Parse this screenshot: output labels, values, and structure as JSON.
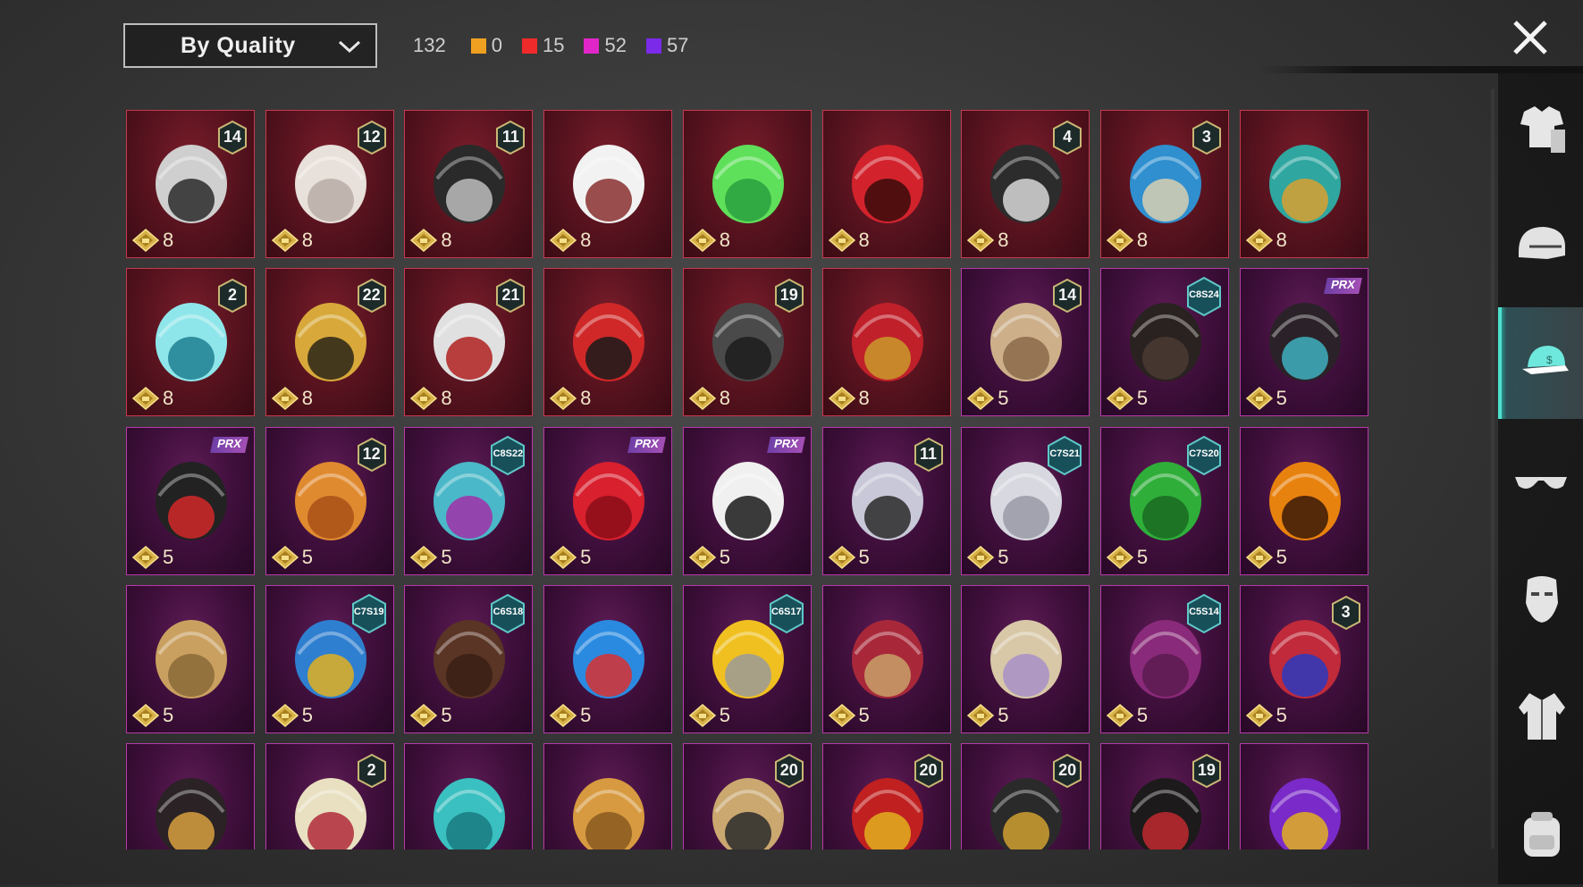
{
  "sort": {
    "label": "By Quality"
  },
  "counts": {
    "total": "132",
    "legendary": {
      "value": "0",
      "color": "#f0a020"
    },
    "mythic": {
      "value": "15",
      "color": "#ee2a2a"
    },
    "epic": {
      "value": "52",
      "color": "#e026c8"
    },
    "rare": {
      "value": "57",
      "color": "#7a2ae8"
    }
  },
  "items": [
    {
      "rarity": "mythic",
      "price": "8",
      "badge": "14",
      "icon": "cat-ear-mask-icon",
      "c1": "#cfcfcf",
      "c2": "#2a2a2a"
    },
    {
      "rarity": "mythic",
      "price": "8",
      "badge": "12",
      "icon": "white-fluffy-hair-icon",
      "c1": "#e8e0da",
      "c2": "#b8aca6"
    },
    {
      "rarity": "mythic",
      "price": "8",
      "badge": "11",
      "icon": "dark-helmet-icon",
      "c1": "#2a2a2a",
      "c2": "#bdbdbd"
    },
    {
      "rarity": "mythic",
      "price": "8",
      "badge": "",
      "icon": "white-cowboy-hat-icon",
      "c1": "#f2f2f2",
      "c2": "#8a3030"
    },
    {
      "rarity": "mythic",
      "price": "8",
      "badge": "",
      "icon": "green-hair-icon",
      "c1": "#5fe05a",
      "c2": "#2aa040"
    },
    {
      "rarity": "mythic",
      "price": "8",
      "badge": "",
      "icon": "red-helmet-icon",
      "c1": "#d2232d",
      "c2": "#3a0a0a"
    },
    {
      "rarity": "mythic",
      "price": "8",
      "badge": "4",
      "icon": "top-hat-mask-icon",
      "c1": "#2c2c2c",
      "c2": "#d8d8d8"
    },
    {
      "rarity": "mythic",
      "price": "8",
      "badge": "3",
      "icon": "joker-mask-icon",
      "c1": "#2f8fcf",
      "c2": "#d8d0b0"
    },
    {
      "rarity": "mythic",
      "price": "8",
      "badge": "",
      "icon": "dragon-helmet-icon",
      "c1": "#2fa6a0",
      "c2": "#d8a030"
    },
    {
      "rarity": "mythic",
      "price": "8",
      "badge": "2",
      "icon": "bucket-hat-goggles-icon",
      "c1": "#8fe6ea",
      "c2": "#1f7f92"
    },
    {
      "rarity": "mythic",
      "price": "8",
      "badge": "22",
      "icon": "golden-helmet-icon",
      "c1": "#d8a93a",
      "c2": "#2a2418"
    },
    {
      "rarity": "mythic",
      "price": "8",
      "badge": "21",
      "icon": "demon-mask-icon",
      "c1": "#e0e0e0",
      "c2": "#b02020"
    },
    {
      "rarity": "mythic",
      "price": "8",
      "badge": "",
      "icon": "oni-mask-icon",
      "c1": "#d02828",
      "c2": "#1a1a1a"
    },
    {
      "rarity": "mythic",
      "price": "8",
      "badge": "19",
      "icon": "knight-helmet-icon",
      "c1": "#4a4a4a",
      "c2": "#1c1c1c"
    },
    {
      "rarity": "mythic",
      "price": "8",
      "badge": "",
      "icon": "red-gold-helmet-icon",
      "c1": "#c0202a",
      "c2": "#c99a2a"
    },
    {
      "rarity": "epic",
      "price": "5",
      "badge": "14",
      "icon": "blonde-hair-flower-icon",
      "c1": "#cdb08a",
      "c2": "#8a6a48"
    },
    {
      "rarity": "epic",
      "price": "5",
      "sbadge": "C8S24",
      "icon": "black-short-hair-icon",
      "c1": "#2a2220",
      "c2": "#4a3a34"
    },
    {
      "rarity": "epic",
      "price": "5",
      "pbadge": "PRX",
      "icon": "black-hair-ribbon-icon",
      "c1": "#2a2228",
      "c2": "#3fb0c0"
    },
    {
      "rarity": "epic",
      "price": "5",
      "pbadge": "PRX",
      "icon": "cap-sunglasses-icon",
      "c1": "#222",
      "c2": "#d22828"
    },
    {
      "rarity": "epic",
      "price": "5",
      "badge": "12",
      "icon": "orange-pigtails-icon",
      "c1": "#e08a30",
      "c2": "#a85018"
    },
    {
      "rarity": "epic",
      "price": "5",
      "sbadge": "C8S22",
      "icon": "teal-purple-hair-icon",
      "c1": "#4ab8c8",
      "c2": "#a030a8"
    },
    {
      "rarity": "epic",
      "price": "5",
      "pbadge": "PRX",
      "icon": "red-hair-icon",
      "c1": "#d8202e",
      "c2": "#8a0e18"
    },
    {
      "rarity": "epic",
      "price": "5",
      "pbadge": "PRX",
      "icon": "panda-mask-icon",
      "c1": "#f0f0f0",
      "c2": "#1a1a1a"
    },
    {
      "rarity": "epic",
      "price": "5",
      "badge": "11",
      "icon": "flower-veil-hair-icon",
      "c1": "#c8c8d8",
      "c2": "#2a2a2a"
    },
    {
      "rarity": "epic",
      "price": "5",
      "sbadge": "C7S21",
      "icon": "silver-hair-icon",
      "c1": "#d8d8e0",
      "c2": "#9a9aa6"
    },
    {
      "rarity": "epic",
      "price": "5",
      "sbadge": "C7S20",
      "icon": "green-pigtails-icon",
      "c1": "#2fae3a",
      "c2": "#1a6a22"
    },
    {
      "rarity": "epic",
      "price": "5",
      "badge": "",
      "icon": "pumpkin-head-icon",
      "c1": "#e8820e",
      "c2": "#3a1a08"
    },
    {
      "rarity": "epic",
      "price": "5",
      "badge": "",
      "icon": "blonde-long-hair-icon",
      "c1": "#caa060",
      "c2": "#8a6a38"
    },
    {
      "rarity": "epic",
      "price": "5",
      "sbadge": "C7S19",
      "icon": "feather-headdress-icon",
      "c1": "#2f7fd0",
      "c2": "#e0b020"
    },
    {
      "rarity": "epic",
      "price": "5",
      "sbadge": "C6S18",
      "icon": "brown-hair-icon",
      "c1": "#5a3424",
      "c2": "#3a2016"
    },
    {
      "rarity": "epic",
      "price": "5",
      "badge": "",
      "icon": "blue-cat-cap-icon",
      "c1": "#2a8ae0",
      "c2": "#d83030"
    },
    {
      "rarity": "epic",
      "price": "5",
      "sbadge": "C6S17",
      "icon": "visor-grey-hair-icon",
      "c1": "#f0c020",
      "c2": "#9a9a9a"
    },
    {
      "rarity": "epic",
      "price": "5",
      "badge": "",
      "icon": "witch-hat-mask-icon",
      "c1": "#a8283a",
      "c2": "#c8a068"
    },
    {
      "rarity": "epic",
      "price": "5",
      "badge": "",
      "icon": "curly-blonde-hair-icon",
      "c1": "#d8c8a8",
      "c2": "#a890c8"
    },
    {
      "rarity": "epic",
      "price": "5",
      "sbadge": "C5S14",
      "icon": "magenta-hair-icon",
      "c1": "#8a2a7a",
      "c2": "#5a1a50"
    },
    {
      "rarity": "epic",
      "price": "5",
      "badge": "3",
      "icon": "jester-hat-icon",
      "c1": "#c02a3a",
      "c2": "#2a3ac0"
    },
    {
      "rarity": "epic",
      "price": "5",
      "badge": "",
      "icon": "black-hair-bow-icon",
      "c1": "#2a2224",
      "c2": "#d8a040"
    },
    {
      "rarity": "epic",
      "price": "5",
      "badge": "2",
      "icon": "blonde-bandana-icon",
      "c1": "#e8e0c0",
      "c2": "#b02a3a"
    },
    {
      "rarity": "epic",
      "price": "5",
      "badge": "",
      "icon": "teal-spiky-hair-icon",
      "c1": "#3ac0c0",
      "c2": "#1a7a80"
    },
    {
      "rarity": "epic",
      "price": "5",
      "badge": "",
      "icon": "potato-head-icon",
      "c1": "#d89a40",
      "c2": "#8a5a20"
    },
    {
      "rarity": "epic",
      "price": "5",
      "badge": "20",
      "icon": "bunny-hat-hair-icon",
      "c1": "#caa870",
      "c2": "#2a2a2a"
    },
    {
      "rarity": "epic",
      "price": "5",
      "badge": "20",
      "icon": "monkey-king-mask-icon",
      "c1": "#c02020",
      "c2": "#e0b020"
    },
    {
      "rarity": "epic",
      "price": "5",
      "badge": "20",
      "icon": "black-gold-helmet-icon",
      "c1": "#2a2a2a",
      "c2": "#d0a030"
    },
    {
      "rarity": "epic",
      "price": "5",
      "badge": "19",
      "icon": "black-hair-bun-icon",
      "c1": "#1c1a1a",
      "c2": "#c02a30"
    },
    {
      "rarity": "epic",
      "price": "5",
      "badge": "",
      "icon": "purple-gold-mask-icon",
      "c1": "#7a2ac8",
      "c2": "#e0b020"
    }
  ],
  "sidebar": [
    {
      "icon": "outfit-icon",
      "active": false
    },
    {
      "icon": "helmet-icon",
      "active": false
    },
    {
      "icon": "cap-icon",
      "active": true
    },
    {
      "icon": "glasses-icon",
      "active": false
    },
    {
      "icon": "mask-icon",
      "active": false
    },
    {
      "icon": "jacket-icon",
      "active": false
    },
    {
      "icon": "backpack-icon",
      "active": false
    }
  ]
}
